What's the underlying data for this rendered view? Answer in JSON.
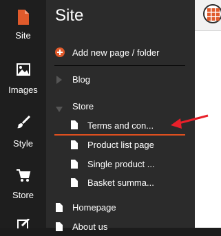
{
  "rail": {
    "items": [
      {
        "label": "Site",
        "icon": "page-icon"
      },
      {
        "label": "Images",
        "icon": "image-icon"
      },
      {
        "label": "Style",
        "icon": "brush-icon"
      },
      {
        "label": "Store",
        "icon": "cart-icon"
      },
      {
        "label": "",
        "icon": "edit-icon"
      }
    ]
  },
  "panel": {
    "title": "Site",
    "add_label": "Add new page / folder",
    "tree": [
      {
        "label": "Blog",
        "type": "folder-collapsed"
      },
      {
        "label": "Store",
        "type": "folder-expanded"
      },
      {
        "label": "Terms and con...",
        "type": "page",
        "active": true
      },
      {
        "label": "Product list page",
        "type": "page"
      },
      {
        "label": "Single product ...",
        "type": "page"
      },
      {
        "label": "Basket summa...",
        "type": "page"
      },
      {
        "label": "Homepage",
        "type": "page"
      },
      {
        "label": "About us",
        "type": "page"
      }
    ]
  },
  "colors": {
    "accent": "#e0501f",
    "arrow": "#e8202a",
    "rail_bg": "#1e1e1e",
    "panel_bg": "#2b2b2b",
    "active_icon": "#e05a2b"
  }
}
